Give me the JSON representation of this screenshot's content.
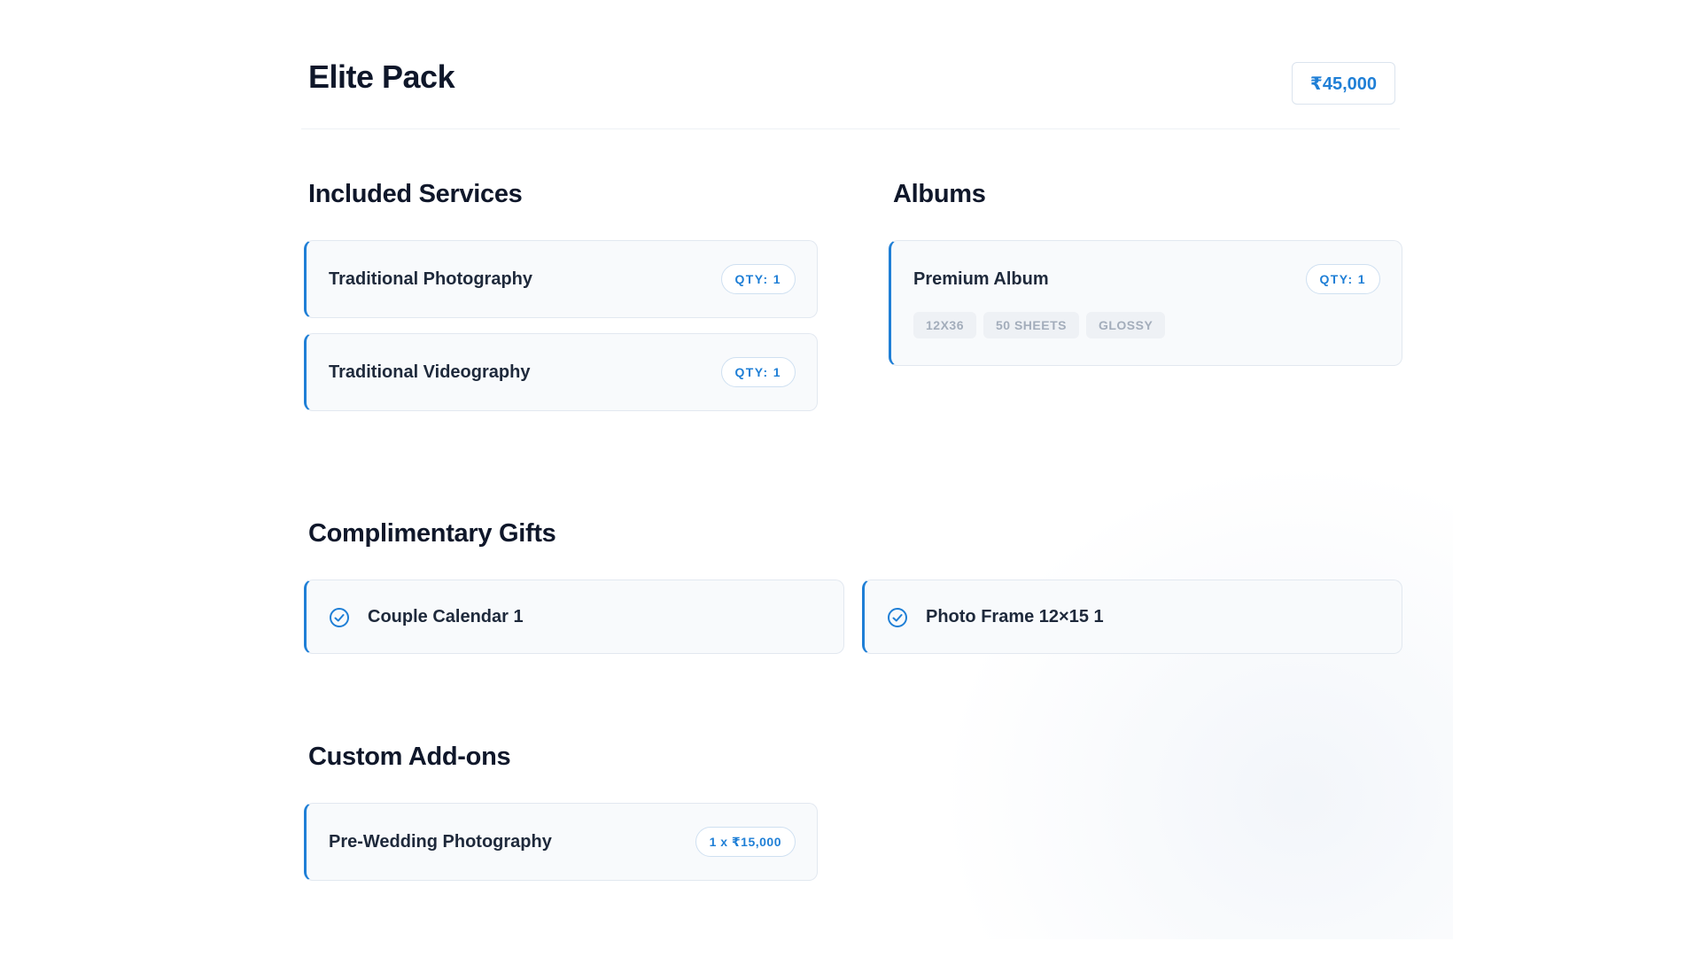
{
  "header": {
    "title": "Elite Pack",
    "price": "₹45,000"
  },
  "included_services": {
    "title": "Included Services",
    "items": [
      {
        "label": "Traditional Photography",
        "qty": "QTY: 1"
      },
      {
        "label": "Traditional Videography",
        "qty": "QTY: 1"
      }
    ]
  },
  "albums": {
    "title": "Albums",
    "items": [
      {
        "label": "Premium Album",
        "qty": "QTY: 1",
        "tags": [
          "12X36",
          "50 SHEETS",
          "GLOSSY"
        ]
      }
    ]
  },
  "complimentary_gifts": {
    "title": "Complimentary Gifts",
    "icon": "check-circle-icon",
    "items": [
      {
        "label": "Couple Calendar 1"
      },
      {
        "label": "Photo Frame 12×15 1"
      }
    ]
  },
  "custom_addons": {
    "title": "Custom Add-ons",
    "items": [
      {
        "label": "Pre-Wedding Photography",
        "price": "1 x ₹15,000"
      }
    ]
  },
  "colors": {
    "accent": "#1f7fd6",
    "text": "#0f172a",
    "card_bg": "#f8fafc",
    "tag_bg": "#eef1f5",
    "tag_text": "#a3adbb"
  }
}
